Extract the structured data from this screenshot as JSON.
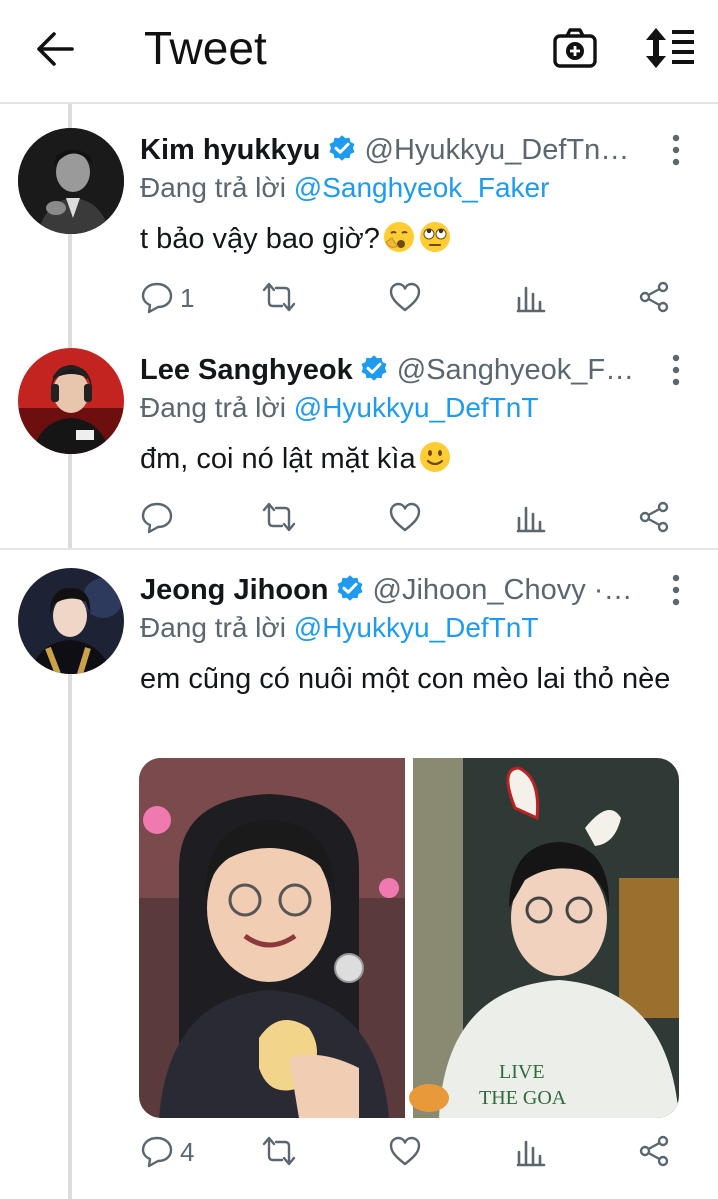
{
  "header": {
    "title": "Tweet"
  },
  "tweets": [
    {
      "name": "Kim hyukkyu",
      "handle": "@Hyukkyu_DefTn…",
      "reply_prefix": "Đang trả lời",
      "reply_to": "@Sanghyeok_Faker",
      "text": "t bảo vậy bao giờ?",
      "emojis": [
        "yawning-face",
        "face-with-rolling-eyes"
      ],
      "reply_count": "1"
    },
    {
      "name": "Lee Sanghyeok",
      "handle": "@Sanghyeok_F…",
      "reply_prefix": "Đang trả lời",
      "reply_to": "@Hyukkyu_DefTnT",
      "text": "đm, coi nó lật mặt kìa",
      "emojis": [
        "slightly-smiling-face"
      ],
      "reply_count": ""
    },
    {
      "name": "Jeong Jihoon",
      "handle": "@Jihoon_Chovy ·…",
      "reply_prefix": "Đang trả lời",
      "reply_to": "@Hyukkyu_DefTnT",
      "text": "em cũng có nuôi một con mèo lai thỏ nèe",
      "media": [
        "photo-laughing-with-banana",
        "photo-with-bunny-ears-headband"
      ],
      "media_text": "LIVE THE GOA",
      "reply_count": "4"
    }
  ],
  "colors": {
    "accent": "#1d9bf0",
    "secondary_text": "#5b6770",
    "verified": "#1d9bf0"
  }
}
